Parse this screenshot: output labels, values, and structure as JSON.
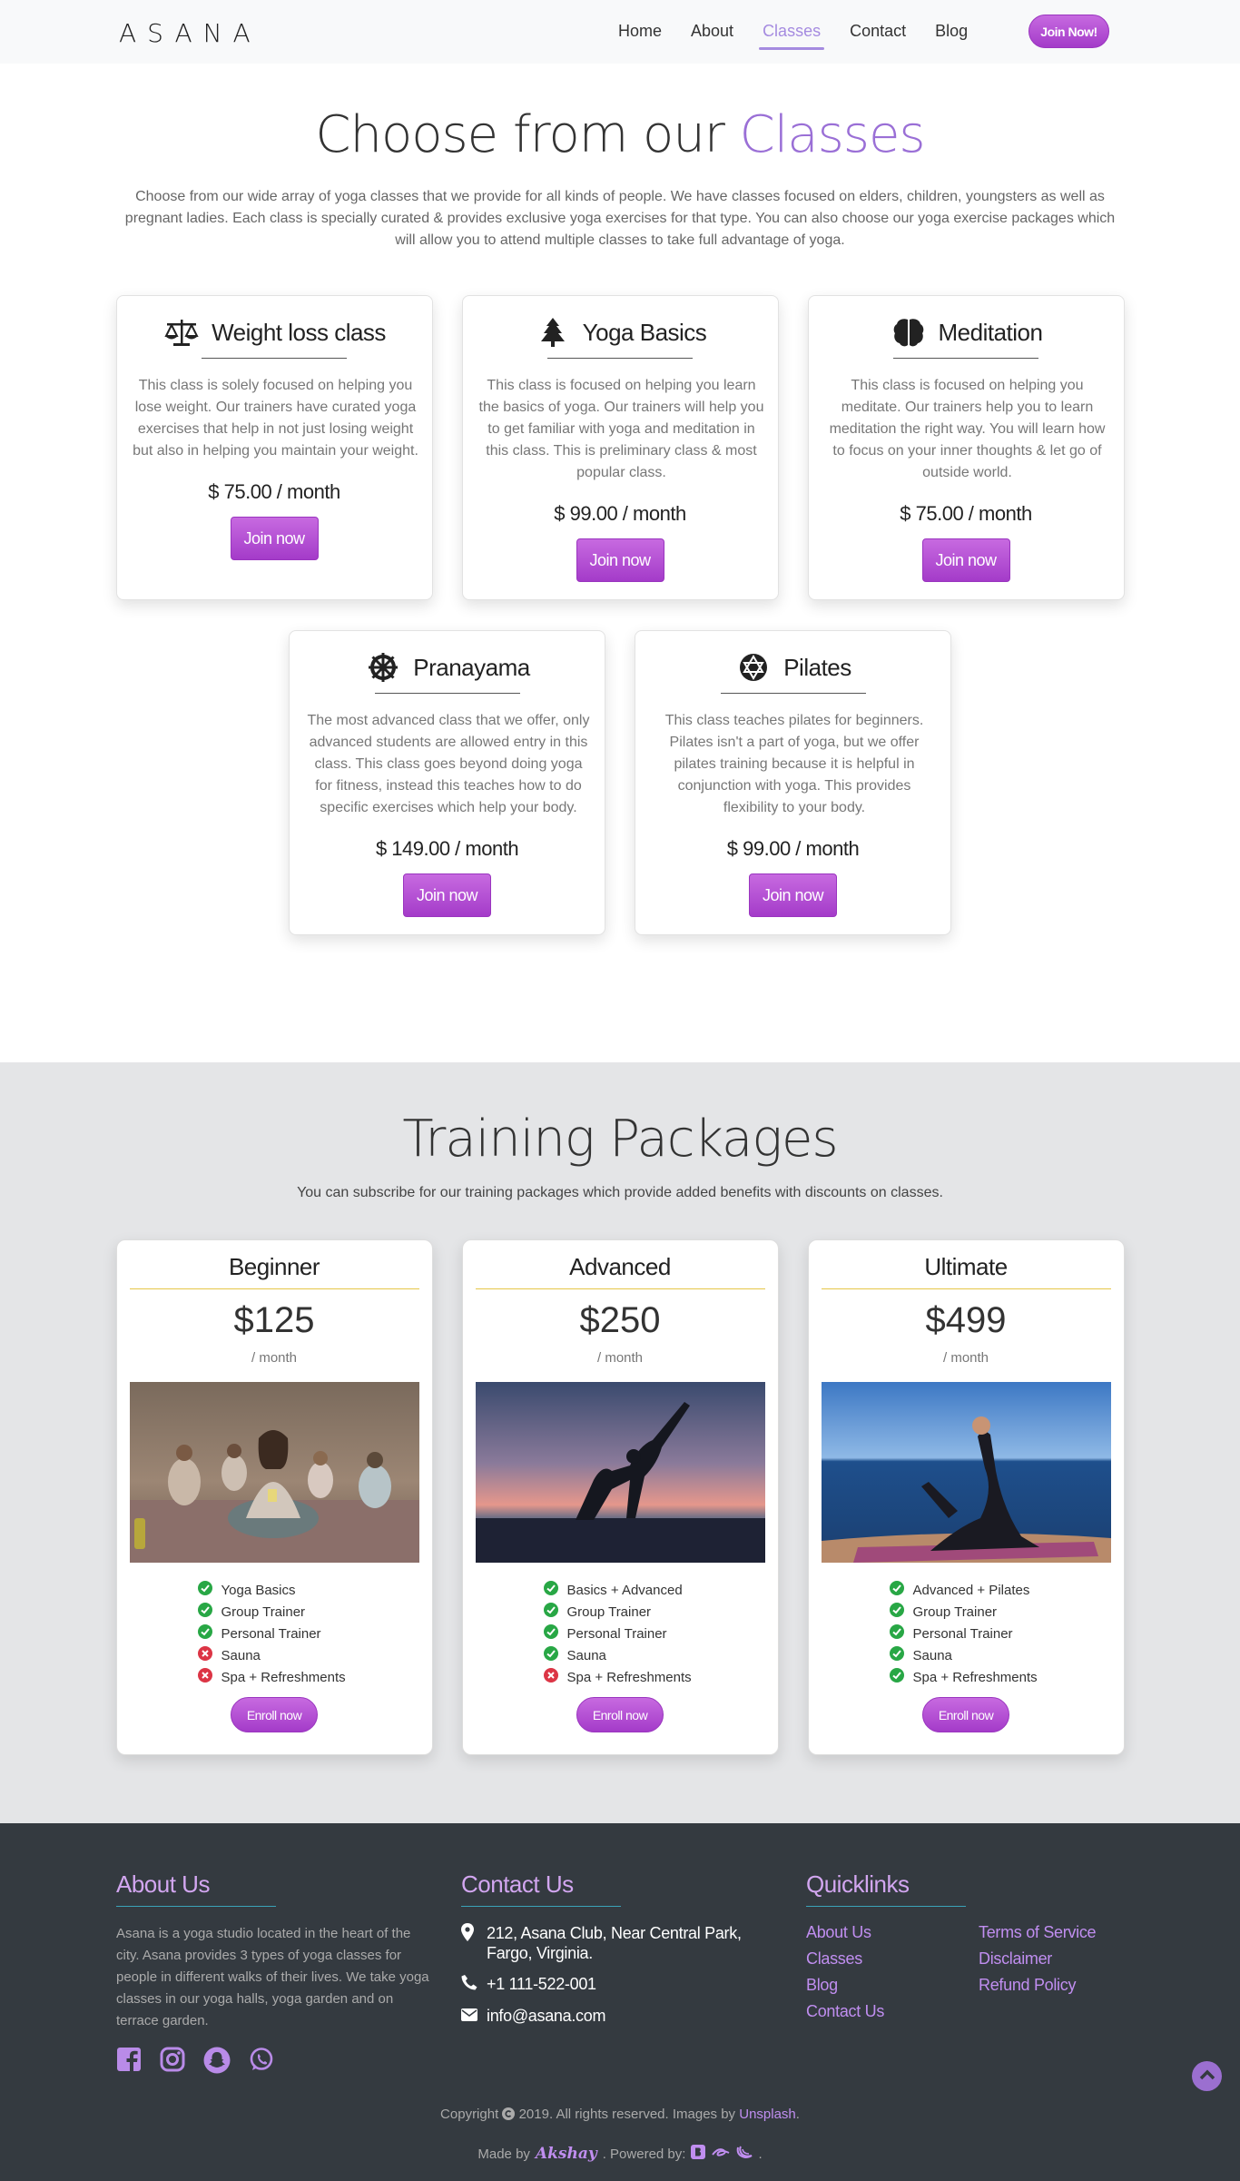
{
  "nav": {
    "logo": "ASANA",
    "links": [
      "Home",
      "About",
      "Classes",
      "Contact",
      "Blog"
    ],
    "active": "Classes",
    "join_label": "Join Now!"
  },
  "classes": {
    "title_main": "Choose from our ",
    "title_accent": "Classes",
    "intro": "Choose from our wide array of yoga classes that we provide for all kinds of people. We have classes focused on elders, children, youngsters as well as pregnant ladies. Each class is specially curated & provides exclusive yoga exercises for that type. You can also choose our yoga exercise packages which will allow you to attend multiple classes to take full advantage of yoga.",
    "cards": [
      {
        "title": "Weight loss class",
        "icon": "balance-scale-icon",
        "desc": "This class is solely focused on helping you lose weight. Our trainers have curated yoga exercises that help in not just losing weight but also in helping you maintain your weight.",
        "price": "$ 75.00 / month",
        "button": "Join now"
      },
      {
        "title": "Yoga Basics",
        "icon": "tree-icon",
        "desc": "This class is focused on helping you learn the basics of yoga. Our trainers will help you to get familiar with yoga and meditation in this class. This is preliminary class & most popular class.",
        "price": "$ 99.00 / month",
        "button": "Join now"
      },
      {
        "title": "Meditation",
        "icon": "brain-icon",
        "desc": "This class is focused on helping you meditate. Our trainers help you to learn meditation the right way. You will learn how to focus on your inner thoughts & let go of outside world.",
        "price": "$ 75.00 / month",
        "button": "Join now"
      },
      {
        "title": "Pranayama",
        "icon": "dharmachakra-icon",
        "desc": "The most advanced class that we offer, only advanced students are allowed entry in this class. This class goes beyond doing yoga for fitness, instead this teaches how to do specific exercises which help your body.",
        "price": "$ 149.00 / month",
        "button": "Join now"
      },
      {
        "title": "Pilates",
        "icon": "star-of-david-icon",
        "desc": "This class teaches pilates for beginners. Pilates isn't a part of yoga, but we offer pilates training because it is helpful in conjunction with yoga. This provides flexibility to your body.",
        "price": "$ 99.00 / month",
        "button": "Join now"
      }
    ]
  },
  "packages": {
    "title": "Training Packages",
    "subtitle": "You can subscribe for our training packages which provide added benefits with discounts on classes.",
    "cards": [
      {
        "name": "Beginner",
        "price": "$125",
        "per": "/ month",
        "image": "group-meditation-photo",
        "features": [
          [
            "Yoga Basics",
            true
          ],
          [
            "Group Trainer",
            true
          ],
          [
            "Personal Trainer",
            true
          ],
          [
            "Sauna",
            false
          ],
          [
            "Spa + Refreshments",
            false
          ]
        ],
        "button": "Enroll now"
      },
      {
        "name": "Advanced",
        "price": "$250",
        "per": "/ month",
        "image": "sunset-yoga-silhouette-photo",
        "features": [
          [
            "Basics + Advanced",
            true
          ],
          [
            "Group Trainer",
            true
          ],
          [
            "Personal Trainer",
            true
          ],
          [
            "Sauna",
            true
          ],
          [
            "Spa + Refreshments",
            false
          ]
        ],
        "button": "Enroll now"
      },
      {
        "name": "Ultimate",
        "price": "$499",
        "per": "/ month",
        "image": "seaside-yoga-photo",
        "features": [
          [
            "Advanced + Pilates",
            true
          ],
          [
            "Group Trainer",
            true
          ],
          [
            "Personal Trainer",
            true
          ],
          [
            "Sauna",
            true
          ],
          [
            "Spa + Refreshments",
            true
          ]
        ],
        "button": "Enroll now"
      }
    ]
  },
  "footer": {
    "about_title": "About Us",
    "about_text": "Asana is a yoga studio located in the heart of the city. Asana provides 3 types of yoga classes for people in different walks of their lives. We take yoga classes in our yoga halls, yoga garden and on terrace garden.",
    "socials": [
      "facebook-icon",
      "instagram-icon",
      "snapchat-icon",
      "whatsapp-icon"
    ],
    "contact_title": "Contact Us",
    "address": "212, Asana Club, Near Central Park, Fargo, Virginia.",
    "phone": "+1 111-522-001",
    "email": "info@asana.com",
    "quick_title": "Quicklinks",
    "quick_links": [
      "About Us",
      "Terms of Service",
      "Classes",
      "Disclaimer",
      "Blog",
      "Refund Policy",
      "Contact Us"
    ],
    "copyright_pre": "Copyright",
    "copyright_mid": "2019. All rights reserved. Images by",
    "copyright_link": "Unsplash",
    "made_by": "Made by",
    "author": "Akshay",
    "powered_by": ". Powered by:"
  },
  "colors": {
    "accent": "#9a6fd6",
    "button": "#b34fd4",
    "footer_bg": "#343a40",
    "link": "#c08ef0",
    "check": "#28a745",
    "cross": "#dc3545"
  }
}
